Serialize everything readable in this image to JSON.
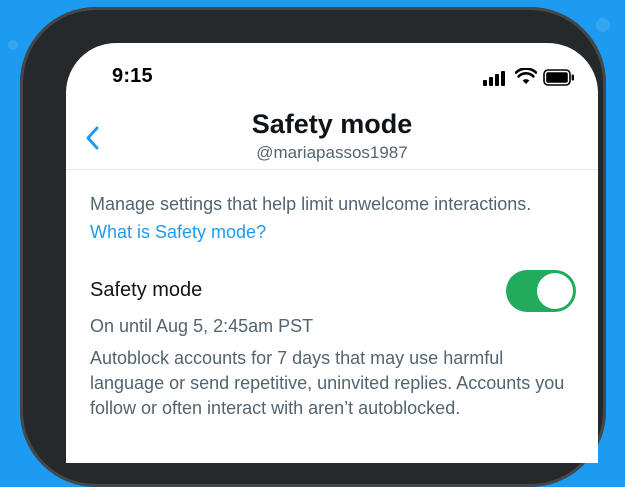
{
  "status_bar": {
    "time": "9:15",
    "signal_icon": "cellular-signal-icon",
    "wifi_icon": "wifi-icon",
    "battery_icon": "battery-icon"
  },
  "header": {
    "back_icon": "chevron-left-icon",
    "title": "Safety mode",
    "subtitle": "@mariapassos1987"
  },
  "content": {
    "description": "Manage settings that help limit unwelcome interactions.",
    "link_text": "What is Safety mode?",
    "setting": {
      "label": "Safety mode",
      "toggle_on": true,
      "status": "On until Aug 5, 2:45am PST",
      "explanation": "Autoblock accounts for 7 days that may use harmful language or send repetitive, uninvited replies. Accounts you follow or often interact with aren’t autoblocked."
    }
  },
  "colors": {
    "background": "#1d9bf0",
    "link": "#1d9bf0",
    "toggle_on": "#22ab5c",
    "secondary_text": "#536471",
    "primary_text": "#0f1419"
  }
}
